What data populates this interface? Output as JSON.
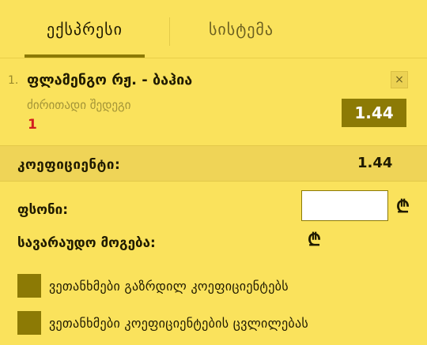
{
  "tabs": {
    "express": "ექსპრესი",
    "system": "სისტემა"
  },
  "bet": {
    "number": "1.",
    "title": "ფლამენგო რჟ. - ბაჰია",
    "market": "ძირითადი შედეგი",
    "outcome": "1",
    "odds": "1.44",
    "remove_label": "×"
  },
  "total": {
    "label": "კოეფიციენტი:",
    "value": "1.44"
  },
  "stake": {
    "label": "ფსონი:",
    "value": "",
    "currency": "₾"
  },
  "potential_win": {
    "label": "სავარაუდო მოგება:",
    "currency": "₾"
  },
  "options": [
    {
      "label": "ვეთანხმები გაზრდილ კოეფიციენტებს"
    },
    {
      "label": "ვეთანხმები კოეფიციენტების ცვლილებას"
    }
  ],
  "colors": {
    "background": "#fae25c",
    "accent": "#8c7a05",
    "outcome": "#d21e1e"
  }
}
